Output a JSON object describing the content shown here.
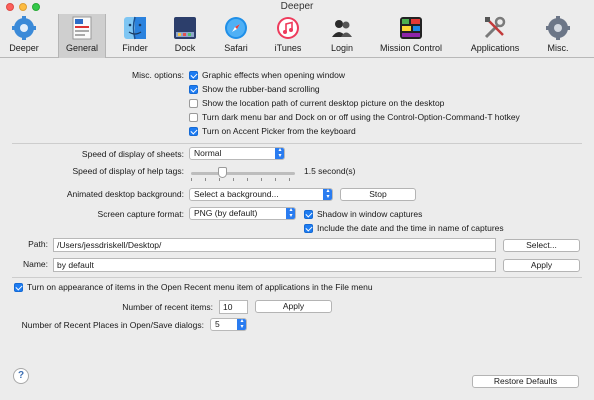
{
  "window": {
    "title": "Deeper"
  },
  "toolbar": {
    "items": [
      {
        "label": "Deeper",
        "icon": "gear-icon"
      },
      {
        "label": "General",
        "icon": "general-prefs-icon",
        "selected": true
      },
      {
        "label": "Finder",
        "icon": "finder-icon"
      },
      {
        "label": "Dock",
        "icon": "dock-icon"
      },
      {
        "label": "Safari",
        "icon": "safari-compass-icon"
      },
      {
        "label": "iTunes",
        "icon": "itunes-icon"
      },
      {
        "label": "Login",
        "icon": "users-icon"
      },
      {
        "label": "Mission Control",
        "icon": "mission-control-icon"
      },
      {
        "label": "Applications",
        "icon": "tools-icon"
      },
      {
        "label": "Misc.",
        "icon": "misc-gear-icon"
      }
    ]
  },
  "misc_options": {
    "label": "Misc. options:",
    "items": [
      {
        "label": "Graphic effects when opening window",
        "checked": true
      },
      {
        "label": "Show the rubber-band scrolling",
        "checked": true
      },
      {
        "label": "Show the location path of current desktop picture on the desktop",
        "checked": false
      },
      {
        "label": "Turn dark menu bar and Dock on or off using the Control-Option-Command-T hotkey",
        "checked": false
      },
      {
        "label": "Turn on Accent Picker from the keyboard",
        "checked": true
      }
    ]
  },
  "sheets_speed": {
    "label": "Speed of display of sheets:",
    "value": "Normal"
  },
  "help_tags_speed": {
    "label": "Speed of display of help tags:",
    "value_text": "1.5 second(s)",
    "position_fraction": 0.3
  },
  "animated_background": {
    "label": "Animated desktop background:",
    "value": "Select a background...",
    "stop_label": "Stop"
  },
  "screen_capture": {
    "label": "Screen capture format:",
    "value": "PNG (by default)",
    "shadow_label": "Shadow in window captures",
    "shadow_checked": true,
    "date_label": "Include the date and the time in name of captures",
    "date_checked": true
  },
  "path": {
    "label": "Path:",
    "value": "/Users/jessdriskell/Desktop/",
    "select_label": "Select..."
  },
  "name": {
    "label": "Name:",
    "value": "by default",
    "apply_label": "Apply"
  },
  "open_recent": {
    "label": "Turn on appearance of items in the Open Recent menu item of applications in the File menu",
    "checked": true,
    "count_label": "Number of recent items:",
    "count_value": "10",
    "apply_label": "Apply"
  },
  "recent_places": {
    "label": "Number of Recent Places in Open/Save dialogs:",
    "value": "5"
  },
  "footer": {
    "help_label": "?",
    "restore_label": "Restore Defaults"
  }
}
